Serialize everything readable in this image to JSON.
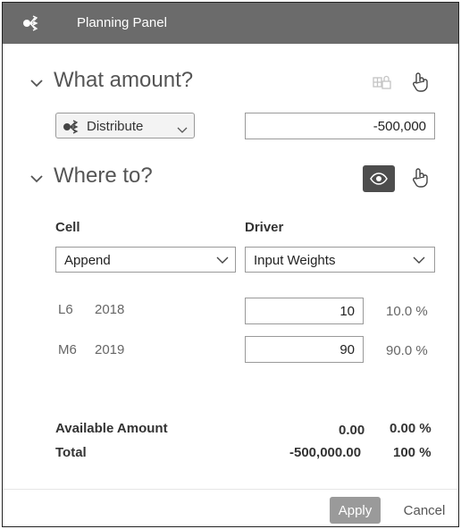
{
  "header": {
    "title": "Planning Panel",
    "icon": "distribute-icon"
  },
  "amount_section": {
    "title": "What amount?",
    "method_select": {
      "value": "Distribute",
      "icon": "distribute-icon"
    },
    "amount_value": "-500,000",
    "tools": [
      "lock-grid-icon",
      "touch-gesture-icon"
    ]
  },
  "where_section": {
    "title": "Where to?",
    "tools": [
      "eye-icon",
      "touch-gesture-icon"
    ],
    "cell_label": "Cell",
    "driver_label": "Driver",
    "cell_select": {
      "value": "Append"
    },
    "driver_select": {
      "value": "Input Weights"
    },
    "rows": [
      {
        "cell": "L6",
        "year": "2018",
        "weight": "10",
        "percent": "10.0 %"
      },
      {
        "cell": "M6",
        "year": "2019",
        "weight": "90",
        "percent": "90.0 %"
      }
    ]
  },
  "summary": {
    "available_label": "Available Amount",
    "available_value": "0.00",
    "available_percent": "0.00 %",
    "total_label": "Total",
    "total_value": "-500,000.00",
    "total_percent": "100 %"
  },
  "footer": {
    "apply_label": "Apply",
    "cancel_label": "Cancel"
  },
  "colors": {
    "header_bg": "#6b6b6b",
    "apply_bg": "#9a9a9a",
    "eye_button_bg": "#4d4d4d"
  }
}
